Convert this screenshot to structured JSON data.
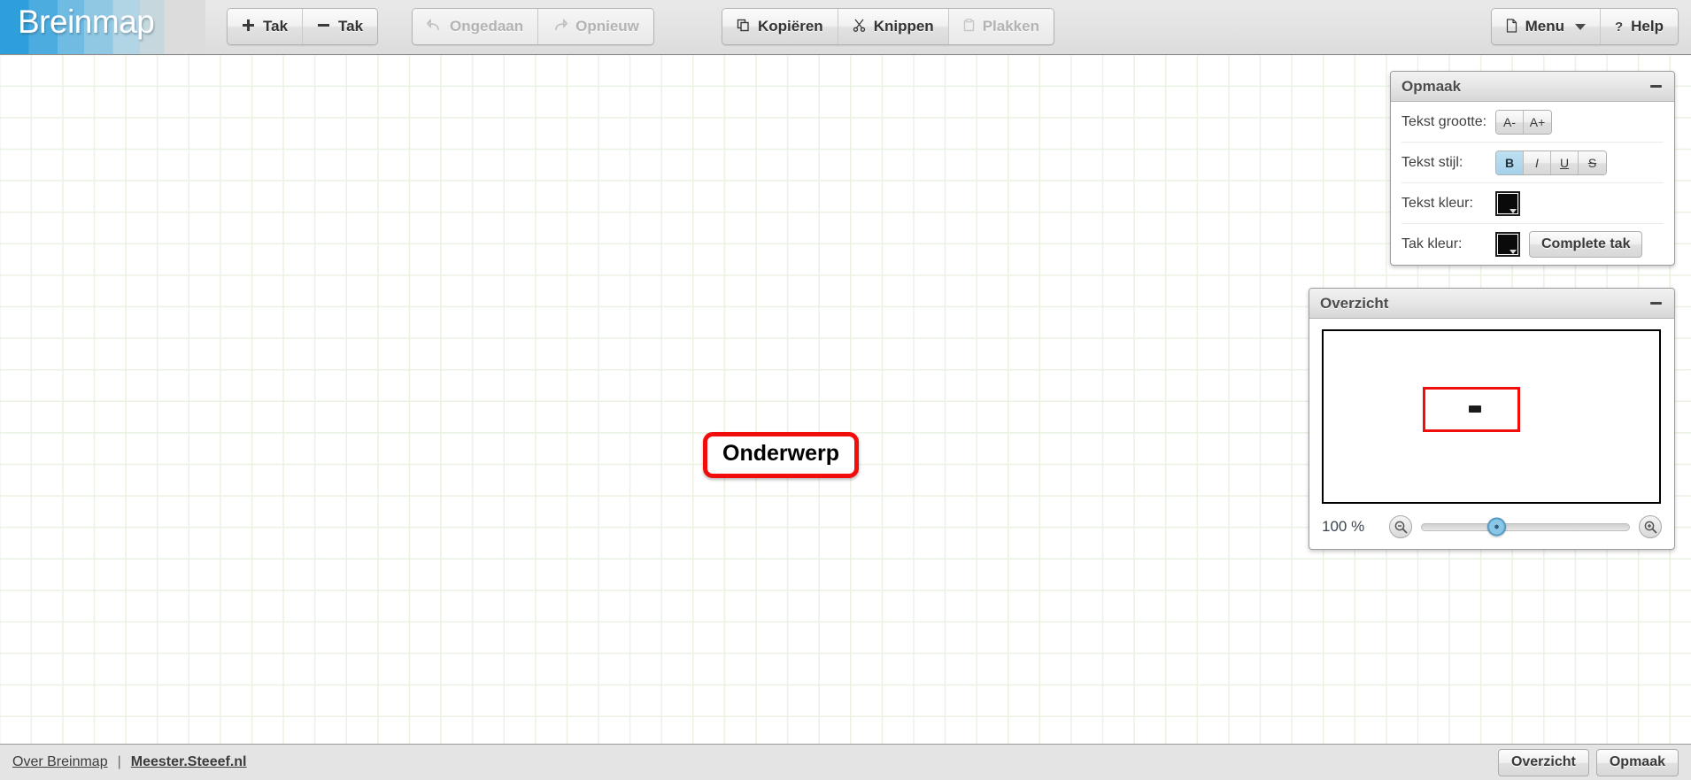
{
  "app": {
    "logo_text": "Breinmap"
  },
  "toolbar": {
    "groups": [
      {
        "name": "branch",
        "buttons": [
          {
            "icon": "plus-icon",
            "glyph": "➕",
            "label": "Tak",
            "disabled": false
          },
          {
            "icon": "minus-icon",
            "glyph": "➖",
            "label": "Tak",
            "disabled": false
          }
        ]
      },
      {
        "name": "history",
        "buttons": [
          {
            "icon": "undo-icon",
            "glyph": "↶",
            "label": "Ongedaan",
            "disabled": true
          },
          {
            "icon": "redo-icon",
            "glyph": "↷",
            "label": "Opnieuw",
            "disabled": true
          }
        ]
      },
      {
        "name": "clipboard",
        "buttons": [
          {
            "icon": "copy-icon",
            "glyph": "❐",
            "label": "Kopiëren",
            "disabled": false
          },
          {
            "icon": "cut-icon",
            "glyph": "✂",
            "label": "Knippen",
            "disabled": false
          },
          {
            "icon": "paste-icon",
            "glyph": "Ὄb",
            "label": "Plakken",
            "disabled": true
          }
        ]
      }
    ],
    "right_buttons": [
      {
        "icon": "document-icon",
        "glyph": "὜b",
        "label": "Menu",
        "has_caret": true
      },
      {
        "icon": "question-icon",
        "glyph": "?",
        "label": "Help",
        "has_caret": false
      }
    ]
  },
  "canvas": {
    "root_node": {
      "label": "Onderwerp",
      "border_color": "#f20d0d",
      "fill_color": "#ffffff",
      "text_color": "#000000"
    }
  },
  "panels": {
    "opmaak": {
      "title": "Opmaak",
      "minimize_icon": "minimize-icon",
      "rows": {
        "text_size": {
          "label": "Tekst grootte:",
          "buttons": [
            {
              "label": "A-",
              "name": "text-smaller-button"
            },
            {
              "label": "A+",
              "name": "text-larger-button"
            }
          ]
        },
        "text_style": {
          "label": "Tekst stijl:",
          "buttons": [
            {
              "label": "B",
              "name": "bold-button",
              "active": true
            },
            {
              "label": "I",
              "name": "italic-button",
              "active": false
            },
            {
              "label": "U",
              "name": "underline-button",
              "active": false
            },
            {
              "label": "S",
              "name": "strikethrough-button",
              "active": false
            }
          ],
          "active_color": "#a4d2ea"
        },
        "text_color": {
          "label": "Tekst kleur:",
          "swatch_color": "#0a0a0a"
        },
        "branch_color": {
          "label": "Tak kleur:",
          "swatch_color": "#0a0a0a",
          "button_label": "Complete tak"
        }
      }
    },
    "overzicht": {
      "title": "Overzicht",
      "minimize_icon": "minimize-icon",
      "zoom_percent": "100 %",
      "zoom_out_icon": "zoom-out-icon",
      "zoom_in_icon": "zoom-in-icon",
      "viewport_color": "#f20d0d",
      "slider_value": 36
    }
  },
  "footer": {
    "links": [
      {
        "label": "Over Breinmap",
        "bold": false
      },
      {
        "label": "Meester.Steeef.nl",
        "bold": true
      }
    ],
    "separator": "|",
    "buttons": [
      {
        "label": "Overzicht",
        "name": "footer-overzicht-button"
      },
      {
        "label": "Opmaak",
        "name": "footer-opmaak-button"
      }
    ]
  }
}
